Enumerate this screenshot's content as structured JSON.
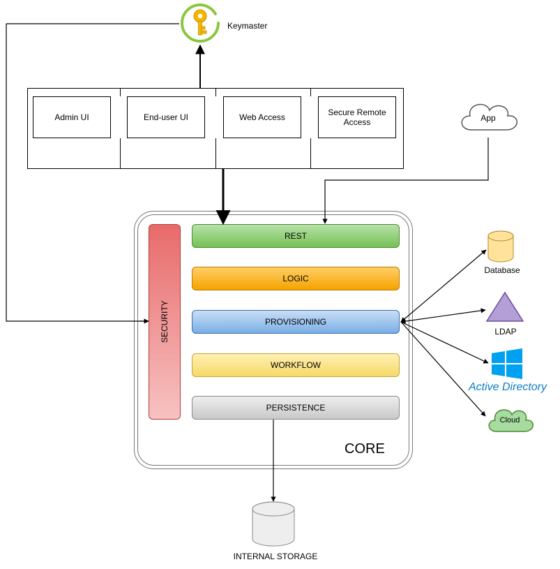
{
  "keymaster": {
    "label": "Keymaster"
  },
  "ui_row": {
    "items": [
      {
        "label": "Admin UI"
      },
      {
        "label": "End-user UI"
      },
      {
        "label": "Web Access"
      },
      {
        "label": "Secure Remote Access"
      }
    ]
  },
  "app": {
    "label": "App"
  },
  "core": {
    "title": "CORE",
    "security": "SECURITY",
    "layers": [
      {
        "label": "REST"
      },
      {
        "label": "LOGIC"
      },
      {
        "label": "PROVISIONING"
      },
      {
        "label": "WORKFLOW"
      },
      {
        "label": "PERSISTENCE"
      }
    ]
  },
  "targets": {
    "database": "Database",
    "ldap": "LDAP",
    "ad": "Active Directory",
    "cloud": "Cloud"
  },
  "storage": {
    "label": "INTERNAL STORAGE"
  }
}
